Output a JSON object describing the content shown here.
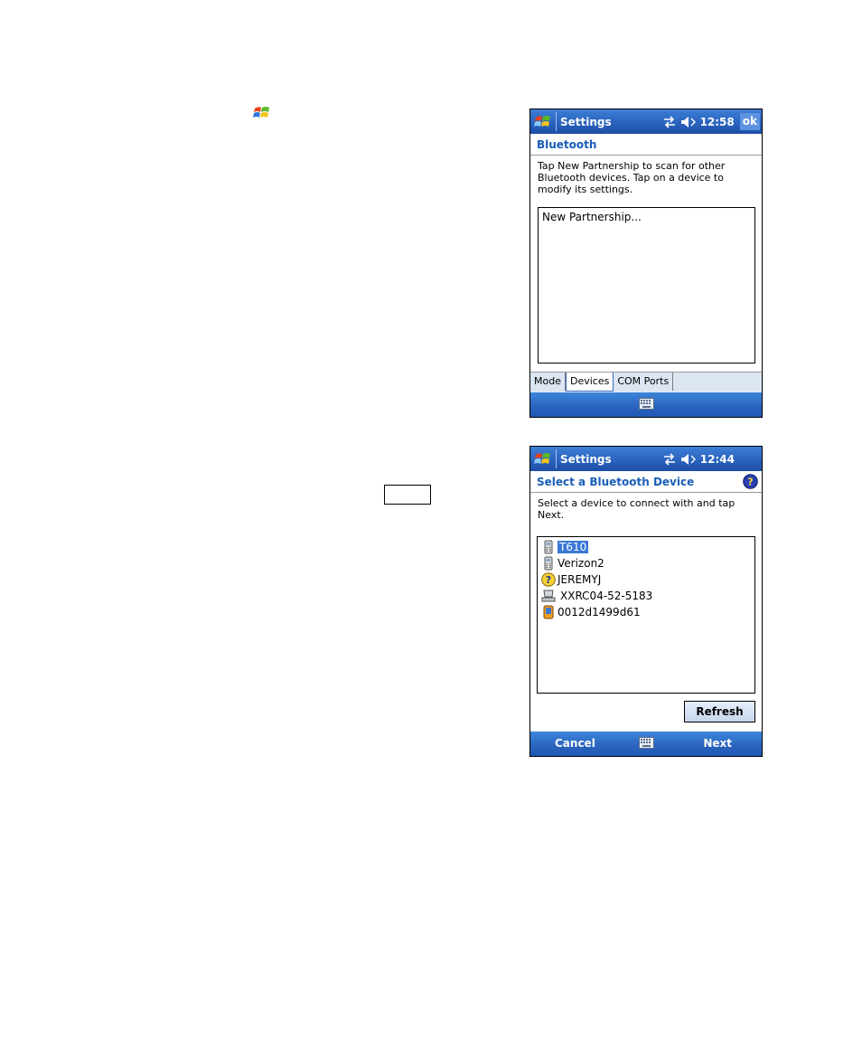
{
  "screen1": {
    "title": "Settings",
    "time": "12:58",
    "ok_label": "ok",
    "header": "Bluetooth",
    "instructions": "Tap New Partnership to scan for other Bluetooth devices. Tap on a device to modify its settings.",
    "list_items": [
      "New Partnership..."
    ],
    "tabs": [
      "Mode",
      "Devices",
      "COM Ports"
    ]
  },
  "screen2": {
    "title": "Settings",
    "time": "12:44",
    "header": "Select a Bluetooth Device",
    "instructions": "Select a device to connect with and tap Next.",
    "devices": [
      {
        "name": "T610",
        "icon": "phone-icon"
      },
      {
        "name": "Verizon2",
        "icon": "phone-icon"
      },
      {
        "name": "JEREMYJ",
        "icon": "unknown-device-icon"
      },
      {
        "name": "XXRC04-52-5183",
        "icon": "computer-icon"
      },
      {
        "name": "0012d1499d61",
        "icon": "pda-icon"
      }
    ],
    "refresh_label": "Refresh",
    "cancel_label": "Cancel",
    "next_label": "Next"
  },
  "colors": {
    "titlebar": "#2a63be",
    "header_text": "#1a5eb8",
    "selection": "#3a78d4",
    "tabs_bg": "#dce6f3"
  }
}
